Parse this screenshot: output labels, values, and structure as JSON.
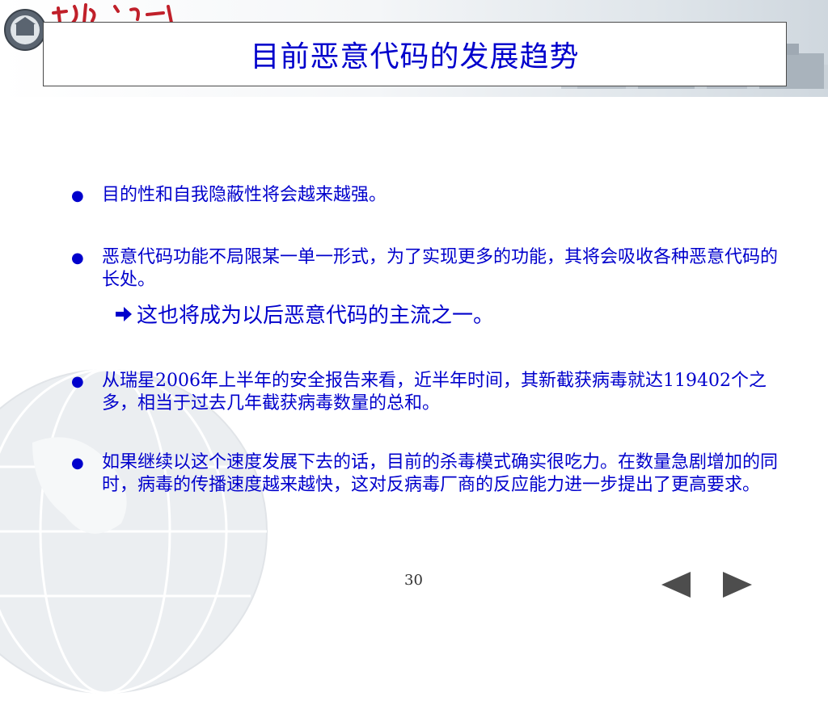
{
  "slide": {
    "title": "目前恶意代码的发展趋势",
    "bullets": [
      {
        "text": "目的性和自我隐蔽性将会越来越强。"
      },
      {
        "text": "恶意代码功能不局限某一单一形式，为了实现更多的功能，其将会吸收各种恶意代码的长处。"
      },
      {
        "text": "从瑞星2006年上半年的安全报告来看，近半年时间，其新截获病毒就达119402个之多，相当于过去几年截获病毒数量的总和。"
      },
      {
        "text": "如果继续以这个速度发展下去的话，目前的杀毒模式确实很吃力。在数量急剧增加的同时，病毒的传播速度越来越快，这对反病毒厂商的反应能力进一步提出了更高要求。"
      }
    ],
    "sub_point": {
      "text": "这也将成为以后恶意代码的主流之一。",
      "icon": "right-arrow-icon"
    },
    "page_number": "30"
  },
  "navigation": {
    "prev_icon": "triangle-left-icon",
    "next_icon": "triangle-right-icon"
  },
  "colors": {
    "text": "#0000cc",
    "title": "#0000cc",
    "nav": "#4d4d4d",
    "calligraphy": "#c0202a"
  }
}
